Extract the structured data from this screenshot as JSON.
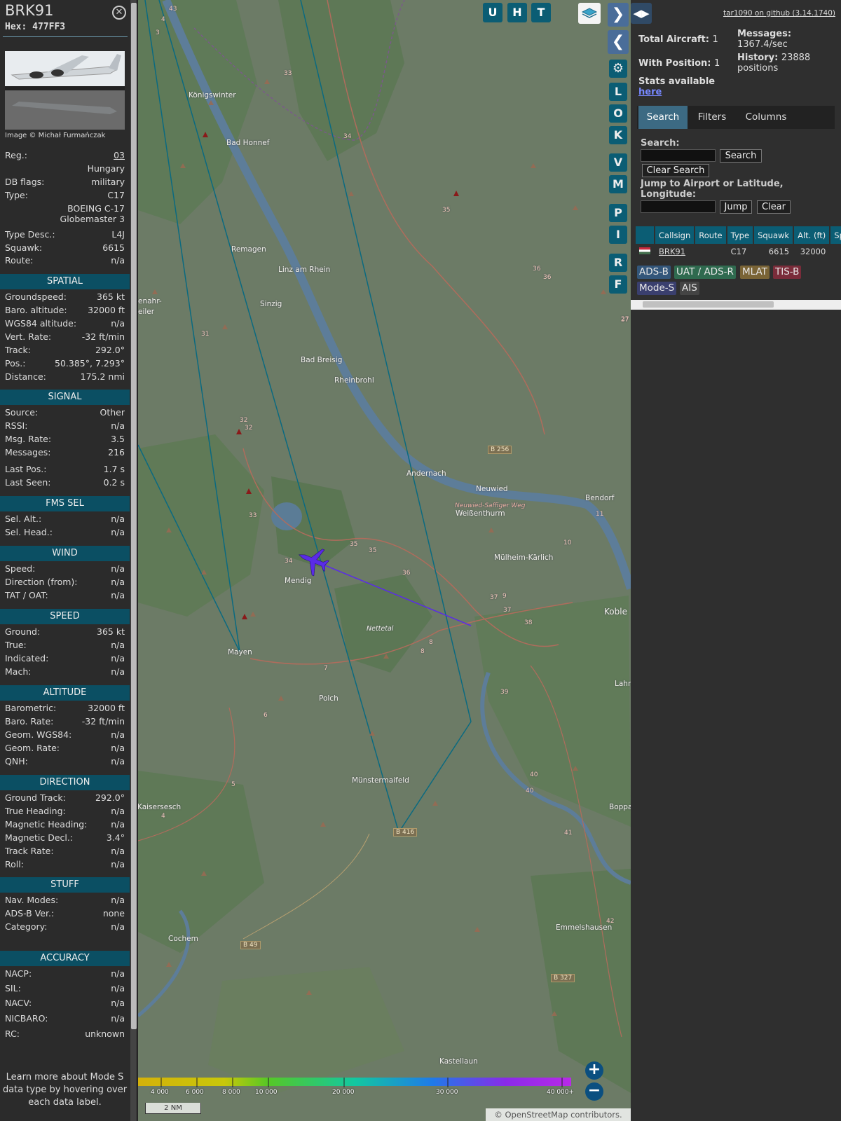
{
  "aircraft": {
    "callsign": "BRK91",
    "hex_label": "Hex:",
    "hex": "477FF3",
    "image_credit": "Image © Michał Furmańczak",
    "fields": [
      {
        "k": "Reg.:",
        "v": "03"
      },
      {
        "k": "",
        "v": "Hungary"
      },
      {
        "k": "DB flags:",
        "v": "military"
      },
      {
        "k": "Type:",
        "v": "C17"
      },
      {
        "k": "",
        "v": "BOEING C-17"
      },
      {
        "k": "",
        "v": "Globemaster 3"
      },
      {
        "k": "Type Desc.:",
        "v": "L4J"
      },
      {
        "k": "Squawk:",
        "v": "6615"
      },
      {
        "k": "Route:",
        "v": "n/a"
      }
    ],
    "sections": {
      "spatial": {
        "title": "SPATIAL",
        "rows": [
          {
            "k": "Groundspeed:",
            "v": "365 kt"
          },
          {
            "k": "Baro. altitude:",
            "v": "32000 ft"
          },
          {
            "k": "WGS84 altitude:",
            "v": "n/a"
          },
          {
            "k": "Vert. Rate:",
            "v": "-32 ft/min"
          },
          {
            "k": "Track:",
            "v": "292.0°"
          },
          {
            "k": "Pos.:",
            "v": "50.385°, 7.293°"
          },
          {
            "k": "Distance:",
            "v": "175.2 nmi"
          }
        ]
      },
      "signal": {
        "title": "SIGNAL",
        "rows": [
          {
            "k": "Source:",
            "v": "Other"
          },
          {
            "k": "RSSI:",
            "v": "n/a"
          },
          {
            "k": "Msg. Rate:",
            "v": "3.5"
          },
          {
            "k": "Messages:",
            "v": "216"
          },
          {
            "k": "Last Pos.:",
            "v": "1.7 s"
          },
          {
            "k": "Last Seen:",
            "v": "0.2 s"
          }
        ]
      },
      "fms": {
        "title": "FMS SEL",
        "rows": [
          {
            "k": "Sel. Alt.:",
            "v": "n/a"
          },
          {
            "k": "Sel. Head.:",
            "v": "n/a"
          }
        ]
      },
      "wind": {
        "title": "WIND",
        "rows": [
          {
            "k": "Speed:",
            "v": "n/a"
          },
          {
            "k": "Direction (from):",
            "v": "n/a"
          },
          {
            "k": "TAT / OAT:",
            "v": "n/a"
          }
        ]
      },
      "speed": {
        "title": "SPEED",
        "rows": [
          {
            "k": "Ground:",
            "v": "365 kt"
          },
          {
            "k": "True:",
            "v": "n/a"
          },
          {
            "k": "Indicated:",
            "v": "n/a"
          },
          {
            "k": "Mach:",
            "v": "n/a"
          }
        ]
      },
      "altitude": {
        "title": "ALTITUDE",
        "rows": [
          {
            "k": "Barometric:",
            "v": "32000 ft"
          },
          {
            "k": "Baro. Rate:",
            "v": "-32 ft/min"
          },
          {
            "k": "Geom. WGS84:",
            "v": "n/a"
          },
          {
            "k": "Geom. Rate:",
            "v": "n/a"
          },
          {
            "k": "QNH:",
            "v": "n/a"
          }
        ]
      },
      "direction": {
        "title": "DIRECTION",
        "rows": [
          {
            "k": "Ground Track:",
            "v": "292.0°"
          },
          {
            "k": "True Heading:",
            "v": "n/a"
          },
          {
            "k": "Magnetic Heading:",
            "v": "n/a"
          },
          {
            "k": "Magnetic Decl.:",
            "v": "3.4°"
          },
          {
            "k": "Track Rate:",
            "v": "n/a"
          },
          {
            "k": "Roll:",
            "v": "n/a"
          }
        ]
      },
      "stuff": {
        "title": "STUFF",
        "rows": [
          {
            "k": "Nav. Modes:",
            "v": "n/a"
          },
          {
            "k": "ADS-B Ver.:",
            "v": "none"
          },
          {
            "k": "Category:",
            "v": "n/a"
          }
        ]
      },
      "accuracy": {
        "title": "ACCURACY",
        "rows": [
          {
            "k": "NACP:",
            "v": "n/a"
          },
          {
            "k": "SIL:",
            "v": "n/a"
          },
          {
            "k": "NACV:",
            "v": "n/a"
          },
          {
            "k": "NICBARO:",
            "v": "n/a"
          },
          {
            "k": "RC:",
            "v": "unknown"
          }
        ]
      }
    },
    "learn_more": "Learn more about Mode S data type by hovering over each data label."
  },
  "map": {
    "top_buttons": [
      "U",
      "H",
      "T"
    ],
    "side_buttons": [
      "L",
      "O",
      "K",
      "V",
      "M",
      "P",
      "I",
      "R",
      "F"
    ],
    "settings_icon": "gear-icon",
    "layers_icon": "layers-icon",
    "place_labels": [
      "Königswinter",
      "Bad Honnef",
      "Remagen",
      "Linz am Rhein",
      "Sinzig",
      "Bad Breisig",
      "Rheinbrohl",
      "Andernach",
      "Neuwied",
      "Weißenthurm",
      "Bendorf",
      "Mülheim-Kärlich",
      "Koble",
      "Mendig",
      "Mayen",
      "Polch",
      "Münstermaifeld",
      "Kaisersesch",
      "Bopparc",
      "Cochem",
      "Emmelshausen",
      "Kastellaun",
      "Nettetal",
      "Neuwied-Saffiger Weg",
      "enahr-",
      "eiler",
      "Lahr"
    ],
    "road_labels": [
      "B 256",
      "B 416",
      "B 49",
      "B 327"
    ],
    "route_numbers": [
      "3",
      "4",
      "43",
      "33",
      "34",
      "35",
      "36",
      "36",
      "37",
      "31",
      "32",
      "32",
      "33",
      "34",
      "35",
      "35",
      "36",
      "37",
      "9",
      "37",
      "38",
      "8",
      "8",
      "39",
      "6",
      "5",
      "4",
      "40",
      "40",
      "41",
      "42",
      "10",
      "11",
      "27",
      "7"
    ],
    "altitude_legend": [
      "4 000",
      "6 000",
      "8 000",
      "10 000",
      "20 000",
      "30 000",
      "40 000+"
    ],
    "scale": "2 NM",
    "attribution": "© OpenStreetMap contributors.",
    "zoom_in": "+",
    "zoom_out": "−",
    "aircraft_color": "#5a2be8"
  },
  "right": {
    "toggle_icon": "◀▶",
    "github": "tar1090 on github (3.14.1740)",
    "total_aircraft_label": "Total Aircraft:",
    "total_aircraft": "1",
    "with_position_label": "With Position:",
    "with_position": "1",
    "messages_label": "Messages:",
    "messages": "1367.4/sec",
    "history_label": "History:",
    "history": "23888 positions",
    "stats_text": "Stats available",
    "stats_link": "here",
    "tabs": [
      "Search",
      "Filters",
      "Columns"
    ],
    "search_label": "Search:",
    "search_button": "Search",
    "clear_search": "Clear Search",
    "jump_label": "Jump to Airport or Latitude, Longitude:",
    "jump_button": "Jump",
    "clear_button": "Clear",
    "table_headers": [
      "",
      "Callsign",
      "Route",
      "Type",
      "Squawk",
      "Alt. (ft)",
      "Spd."
    ],
    "table_rows": [
      {
        "callsign": "BRK91",
        "route": "",
        "type": "C17",
        "squawk": "6615",
        "alt": "32000",
        "spd": ""
      }
    ],
    "source_badges": [
      {
        "label": "ADS-B",
        "color": "#33567a"
      },
      {
        "label": "UAT / ADS-R",
        "color": "#2f6a4f"
      },
      {
        "label": "MLAT",
        "color": "#7a6436"
      },
      {
        "label": "TIS-B",
        "color": "#7a2c3a"
      },
      {
        "label": "Mode-S",
        "color": "#3a3f6e"
      },
      {
        "label": "AIS",
        "color": "#444444"
      }
    ]
  }
}
